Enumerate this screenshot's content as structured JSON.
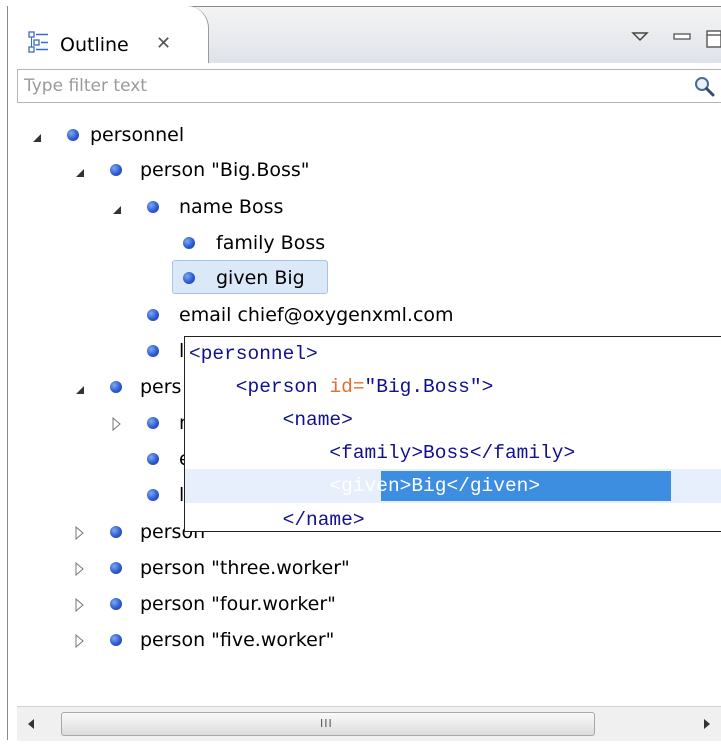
{
  "view": {
    "title": "Outline",
    "close_glyph": "✕",
    "icons": {
      "tab": "outline-icon",
      "menu": "view-menu-icon",
      "minimize": "minimize-icon",
      "maximize": "maximize-icon"
    }
  },
  "filter": {
    "placeholder": "Type filter text",
    "value": "",
    "icon": "search-icon"
  },
  "tree": {
    "n0": "personnel",
    "n1": "person \"Big.Boss\"",
    "n2": "name  Boss",
    "n3": "family  Boss",
    "n4": "given  Big",
    "n5": "email  chief@oxygenxml.com",
    "n6": "l",
    "n7": "pers",
    "n8": "n",
    "n9": "e",
    "n10": "l",
    "n11": "person",
    "n12": "person \"three.worker\"",
    "n13": "person \"four.worker\"",
    "n14": "person \"five.worker\"",
    "selected": "n4"
  },
  "popup": {
    "l1": "<personnel>",
    "l2_open": "    <person ",
    "l2_attr": "id=",
    "l2_val": "\"Big.Boss\">",
    "l3": "        <name>",
    "l4": "            <family>Boss</family>",
    "l5_indent": "            ",
    "l5_sel": "<given>Big</given>",
    "l6": "        </name>"
  },
  "scrollbar": {
    "grip": "III"
  },
  "colors": {
    "bullet": "#2c5bd0",
    "selection": "#dbe8f8",
    "code_tag": "#101090",
    "code_attr": "#e07030",
    "code_selection": "#3d8ee0"
  }
}
